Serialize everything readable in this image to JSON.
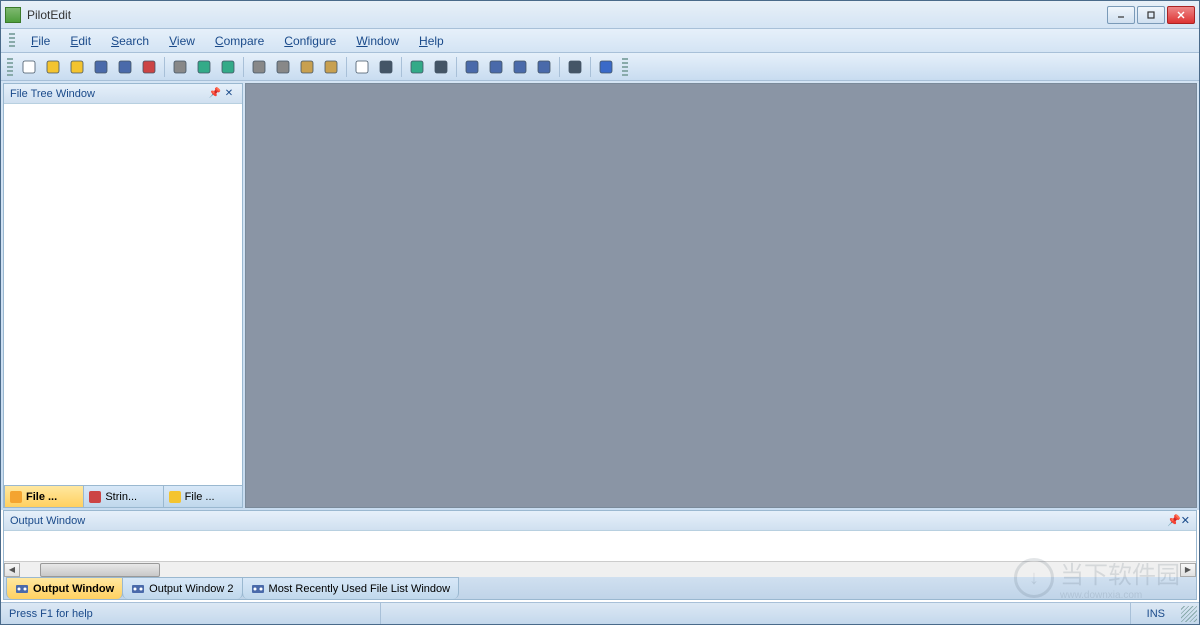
{
  "app": {
    "title": "PilotEdit"
  },
  "menus": [
    {
      "label": "File",
      "u": "F"
    },
    {
      "label": "Edit",
      "u": "E"
    },
    {
      "label": "Search",
      "u": "S"
    },
    {
      "label": "View",
      "u": "V"
    },
    {
      "label": "Compare",
      "u": "C"
    },
    {
      "label": "Configure",
      "u": "C"
    },
    {
      "label": "Window",
      "u": "W"
    },
    {
      "label": "Help",
      "u": "H"
    }
  ],
  "toolbar_icons": [
    "new-file-icon",
    "open-file-icon",
    "open-ftp-icon",
    "save-icon",
    "save-all-icon",
    "close-icon",
    "sep",
    "cut-icon",
    "undo-icon",
    "redo-icon",
    "sep",
    "search-icon",
    "copy-icon",
    "paste-icon",
    "paste-special-icon",
    "sep",
    "document-icon",
    "sort-icon",
    "sep",
    "run-icon",
    "first-icon",
    "sep",
    "bookmark-icon",
    "bookmark-next-icon",
    "bookmark-prev-icon",
    "bookmark-clear-icon",
    "sep",
    "hex-icon",
    "sep",
    "help-icon"
  ],
  "sidebar": {
    "title": "File Tree Window",
    "tabs": [
      {
        "label": "File ...",
        "icon": "tree-icon",
        "active": true
      },
      {
        "label": "Strin...",
        "icon": "string-icon",
        "active": false
      },
      {
        "label": "File ...",
        "icon": "star-icon",
        "active": false
      }
    ]
  },
  "output": {
    "title": "Output Window",
    "tabs": [
      {
        "label": "Output Window",
        "icon": "output-icon",
        "active": true
      },
      {
        "label": "Output Window 2",
        "icon": "output-icon",
        "active": false
      },
      {
        "label": "Most Recently Used File List Window",
        "icon": "mru-icon",
        "active": false
      }
    ]
  },
  "status": {
    "help": "Press F1 for help",
    "mode": "INS"
  },
  "watermark": {
    "text": "当下软件园",
    "sub": "www.downxia.com"
  }
}
